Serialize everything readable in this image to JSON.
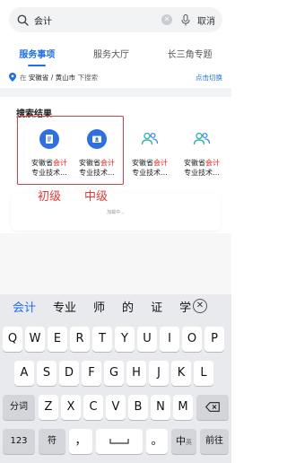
{
  "search": {
    "value": "会计",
    "cancel_label": "取消"
  },
  "tabs": [
    {
      "label": "服务事项",
      "active": true
    },
    {
      "label": "服务大厅",
      "active": false
    },
    {
      "label": "长三角专题",
      "active": false
    }
  ],
  "location": {
    "prefix": "在",
    "region": "安徽省 / 黄山市",
    "suffix": "下搜索",
    "switch_label": "点击切换"
  },
  "results": {
    "title": "搜索结果",
    "cards": [
      {
        "name_pre": "安徽省",
        "name_hl": "会计",
        "sub": "专业技术...",
        "icon": "document-icon"
      },
      {
        "name_pre": "安徽省",
        "name_hl": "会计",
        "sub": "专业技术...",
        "icon": "id-card-icon"
      },
      {
        "name_pre": "安徽省",
        "name_hl": "会计",
        "sub": "专业技术...",
        "icon": "people-icon"
      },
      {
        "name_pre": "安徽省",
        "name_hl": "会计",
        "sub": "专业技术...",
        "icon": "people-icon"
      }
    ]
  },
  "annotations": {
    "left": "初级",
    "right": "中级"
  },
  "loading_text": "加载中...",
  "keyboard": {
    "candidates": [
      "会计",
      "专业",
      "师",
      "的",
      "证",
      "学"
    ],
    "row1": [
      "Q",
      "W",
      "E",
      "R",
      "T",
      "Y",
      "U",
      "I",
      "O",
      "P"
    ],
    "row2": [
      "A",
      "S",
      "D",
      "F",
      "G",
      "H",
      "J",
      "K",
      "L"
    ],
    "row3": [
      "分词",
      "Z",
      "X",
      "C",
      "V",
      "B",
      "N",
      "M"
    ],
    "row4": {
      "num": "123",
      "sym": "符",
      "comma": "，",
      "period": "。",
      "lang": "中",
      "lang_sub": "英",
      "go": "前往"
    }
  },
  "colors": {
    "accent": "#1f6fe5",
    "highlight": "#e02020",
    "annotation": "#e23a3a"
  }
}
